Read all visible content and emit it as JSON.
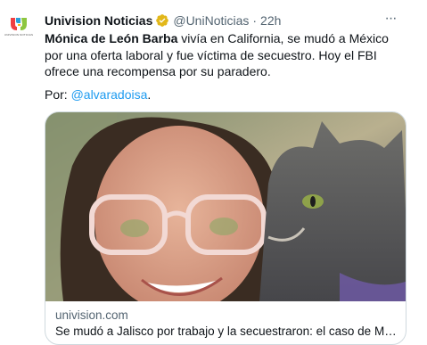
{
  "tweet": {
    "author_name": "Univision Noticias",
    "handle": "@UniNoticias",
    "separator": "·",
    "time": "22h",
    "more_label": "···",
    "text_bold": "Mónica de León Barba",
    "text_rest": " vivía en California, se mudó a México por una oferta laboral y fue víctima de secuestro. Hoy el FBI ofrece una recompensa por su paradero.",
    "byline_prefix": "Por: ",
    "byline_mention": "@alvaradoisa",
    "byline_suffix": "."
  },
  "card": {
    "domain": "univision.com",
    "title": "Se mudó a Jalisco por trabajo y la secuestraron: el caso de Mónica de León Barba"
  },
  "colors": {
    "accent": "#1d9bf0",
    "verified_badge": "#e2b719",
    "secondary_text": "#536471"
  },
  "icons": {
    "verified": "verified-badge-icon",
    "more": "more-options-icon",
    "avatar": "univision-logo"
  }
}
